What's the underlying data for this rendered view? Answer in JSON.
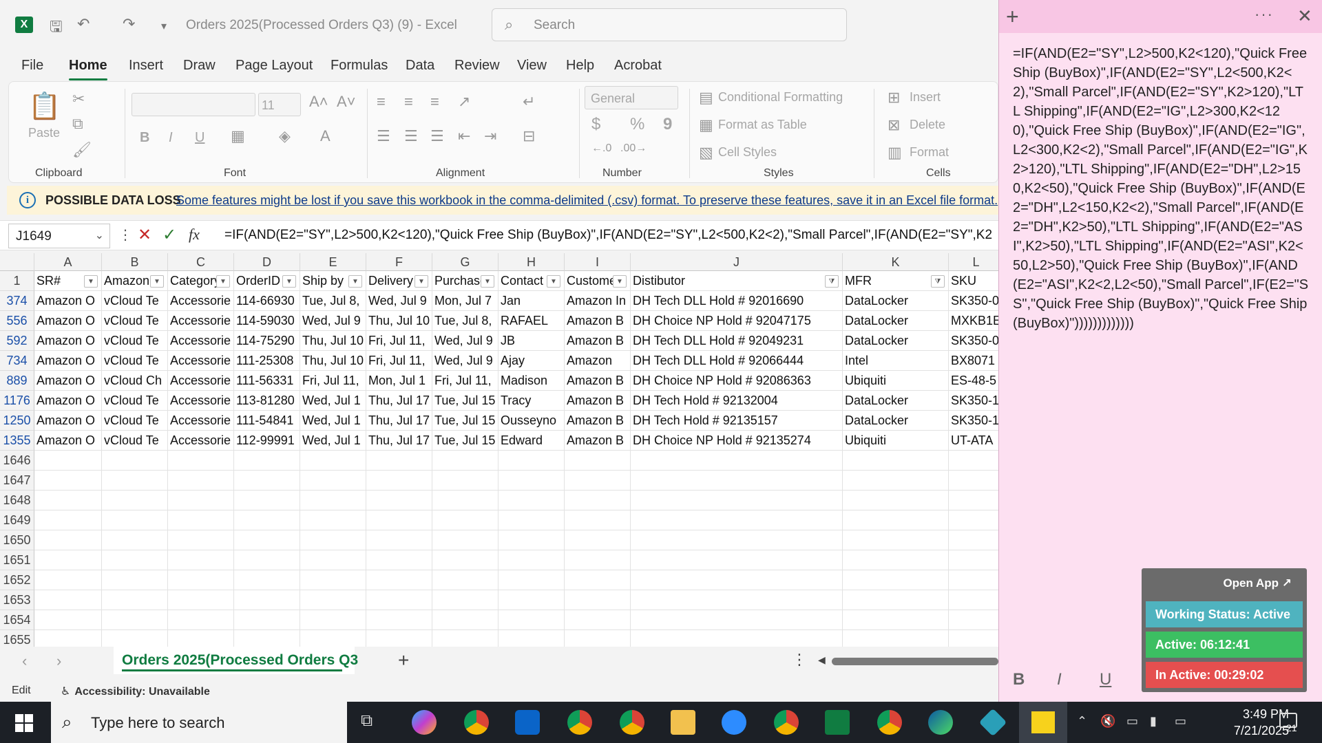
{
  "titlebar": {
    "app_logo": "X",
    "doc_title": "Orders 2025(Processed Orders Q3) (9)  -  Excel",
    "search_placeholder": "Search"
  },
  "menu": [
    "File",
    "Home",
    "Insert",
    "Draw",
    "Page Layout",
    "Formulas",
    "Data",
    "Review",
    "View",
    "Help",
    "Acrobat"
  ],
  "ribbon": {
    "clipboard": {
      "label": "Clipboard",
      "paste": "Paste"
    },
    "font": {
      "label": "Font",
      "size": "11",
      "bold": "B",
      "italic": "I",
      "underline": "U"
    },
    "alignment": {
      "label": "Alignment"
    },
    "number": {
      "label": "Number",
      "format": "General",
      "dollar": "$",
      "percent": "%",
      "comma": "9"
    },
    "styles": {
      "label": "Styles",
      "conditional": "Conditional Formatting",
      "table": "Format as Table",
      "cell": "Cell Styles"
    },
    "cells": {
      "label": "Cells",
      "insert": "Insert",
      "delete": "Delete",
      "format": "Format"
    }
  },
  "infobar": {
    "title": "POSSIBLE DATA LOSS",
    "message": "Some features might be lost if you save this workbook in the comma-delimited (.csv) format. To preserve these features, save it in an Excel file format."
  },
  "formula_bar": {
    "name_box": "J1649",
    "fx": "fx",
    "formula": "=IF(AND(E2=\"SY\",L2>500,K2<120),\"Quick Free Ship (BuyBox)\",IF(AND(E2=\"SY\",L2<500,K2<2),\"Small Parcel\",IF(AND(E2=\"SY\",K2"
  },
  "grid": {
    "columns": [
      "A",
      "B",
      "C",
      "D",
      "E",
      "F",
      "G",
      "H",
      "I",
      "J",
      "K",
      "L"
    ],
    "header_row_num": "1",
    "headers": [
      "SR#",
      "Amazon",
      "Category",
      "OrderID",
      "Ship by",
      "Delivery",
      "Purchase",
      "Contact",
      "Customer",
      "Distibutor",
      "MFR",
      "SKU"
    ],
    "rows": [
      {
        "num": "374",
        "cells": [
          "Amazon O",
          "vCloud Te",
          "Accessorie",
          "114-66930",
          "Tue, Jul 8,",
          "Wed, Jul 9",
          "Mon, Jul 7",
          "Jan",
          "Amazon In",
          "DH Tech DLL Hold # 92016690",
          "DataLocker",
          "SK350-0"
        ]
      },
      {
        "num": "556",
        "cells": [
          "Amazon O",
          "vCloud Te",
          "Accessorie",
          "114-59030",
          "Wed, Jul 9",
          "Thu, Jul 10",
          "Tue, Jul 8,",
          "RAFAEL",
          "Amazon B",
          "DH Choice NP Hold # 92047175",
          "DataLocker",
          "MXKB1E"
        ]
      },
      {
        "num": "592",
        "cells": [
          "Amazon O",
          "vCloud Te",
          "Accessorie",
          "114-75290",
          "Thu, Jul 10",
          "Fri, Jul 11,",
          "Wed, Jul 9",
          "JB",
          "Amazon B",
          "DH Tech DLL Hold # 92049231",
          "DataLocker",
          "SK350-0"
        ]
      },
      {
        "num": "734",
        "cells": [
          "Amazon O",
          "vCloud Te",
          "Accessorie",
          "111-25308",
          "Thu, Jul 10",
          "Fri, Jul 11,",
          "Wed, Jul 9",
          "Ajay",
          "Amazon",
          "DH Tech DLL Hold # 92066444",
          "Intel",
          "BX8071"
        ]
      },
      {
        "num": "889",
        "cells": [
          "Amazon O",
          "vCloud Ch",
          "Accessorie",
          "111-56331",
          "Fri, Jul 11,",
          "Mon, Jul 1",
          "Fri, Jul 11,",
          "Madison",
          "Amazon B",
          "DH Choice NP Hold # 92086363",
          "Ubiquiti",
          "ES-48-5"
        ]
      },
      {
        "num": "1176",
        "cells": [
          "Amazon O",
          "vCloud Te",
          "Accessorie",
          "113-81280",
          "Wed, Jul 1",
          "Thu, Jul 17",
          "Tue, Jul 15",
          "Tracy",
          "Amazon B",
          "DH Tech Hold # 92132004",
          "DataLocker",
          "SK350-1"
        ]
      },
      {
        "num": "1250",
        "cells": [
          "Amazon O",
          "vCloud Te",
          "Accessorie",
          "111-54841",
          "Wed, Jul 1",
          "Thu, Jul 17",
          "Tue, Jul 15",
          "Ousseyno",
          "Amazon B",
          "DH Tech Hold # 92135157",
          "DataLocker",
          "SK350-1"
        ]
      },
      {
        "num": "1355",
        "cells": [
          "Amazon O",
          "vCloud Te",
          "Accessorie",
          "112-99991",
          "Wed, Jul 1",
          "Thu, Jul 17",
          "Tue, Jul 15",
          "Edward",
          "Amazon B",
          "DH Choice NP Hold # 92135274",
          "Ubiquiti",
          "UT-ATA"
        ]
      }
    ],
    "empty_rows": [
      "1646",
      "1647",
      "1648",
      "1649",
      "1650",
      "1651",
      "1652",
      "1653",
      "1654",
      "1655"
    ]
  },
  "sheet_tabs": {
    "active": "Orders 2025(Processed Orders Q3",
    "add": "+"
  },
  "status": {
    "mode": "Edit",
    "accessibility": "Accessibility: Unavailable"
  },
  "sticky_note": {
    "text": "=IF(AND(E2=\"SY\",L2>500,K2<120),\"Quick Free Ship (BuyBox)\",IF(AND(E2=\"SY\",L2<500,K2<2),\"Small Parcel\",IF(AND(E2=\"SY\",K2>120),\"LTL Shipping\",IF(AND(E2=\"IG\",L2>300,K2<120),\"Quick Free Ship (BuyBox)\",IF(AND(E2=\"IG\",L2<300,K2<2),\"Small Parcel\",IF(AND(E2=\"IG\",K2>120),\"LTL Shipping\",IF(AND(E2=\"DH\",L2>150,K2<50),\"Quick Free Ship (BuyBox)\",IF(AND(E2=\"DH\",L2<150,K2<2),\"Small Parcel\",IF(AND(E2=\"DH\",K2>50),\"LTL Shipping\",IF(AND(E2=\"ASI\",K2>50),\"LTL Shipping\",IF(AND(E2=\"ASI\",K2<50,L2>50),\"Quick Free Ship (BuyBox)\",IF(AND(E2=\"ASI\",K2<2,L2<50),\"Small Parcel\",IF(E2=\"SS\",\"Quick Free Ship (BuyBox)\",\"Quick Free Ship (BuyBox)\")))))))))))))",
    "bold": "B",
    "italic": "I",
    "underline": "U"
  },
  "widget": {
    "open_app": "Open App ↗",
    "status": "Working Status: Active",
    "active": "Active: 06:12:41",
    "inactive": "In Active: 00:29:02"
  },
  "taskbar": {
    "search_placeholder": "Type here to search",
    "time": "3:49 PM",
    "date": "7/21/2025",
    "notifications": "21"
  },
  "colors": {
    "excel_green": "#107c41",
    "info_bg": "#fdf4d9",
    "sticky_bg": "#fde0f1",
    "status_active": "#4fb3bf",
    "timer_active": "#3cbf62",
    "timer_inactive": "#e54f4f"
  }
}
